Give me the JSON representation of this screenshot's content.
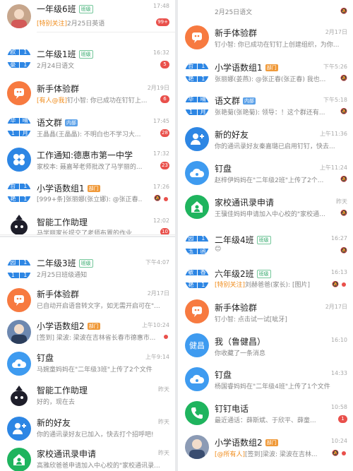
{
  "tl": {
    "rows": [
      {
        "title": "一年级6班",
        "tag": "班级",
        "sub_hl": "[特别关注]",
        "sub": "2月25日英语",
        "time": "17:48",
        "badge": "99+"
      },
      {
        "title": "二年级1班",
        "tag": "班级",
        "sub": "2月24日语文",
        "time": "16:32",
        "badge": "5",
        "av": [
          "欧",
          "1",
          "豪",
          "1"
        ]
      },
      {
        "title": "新手体验群",
        "sub_hl": "[有人@我]",
        "sub": "钉小智: 你已成功在钉钉上...",
        "time": "2月19日",
        "badge": "6"
      },
      {
        "title": "语文群",
        "tag": "内部",
        "sub": "王晶晶(王晶晶): 不明白也不学习大...",
        "time": "17:45",
        "badge": "28",
        "av": [
          "华",
          "晴",
          "1",
          "月"
        ]
      },
      {
        "title": "工作通知:德惠市第一中学",
        "sub": "家校本: 聂嘉琴老师批改了马学丽的...",
        "time": "17:32",
        "badge": "23"
      },
      {
        "title": "小学语数组1",
        "tag": "部门",
        "sub": "[999+条]张丽娜(张立娜): @张正春...",
        "time": "17:26",
        "av": [
          "哲",
          "1",
          "艳",
          "1"
        ]
      },
      {
        "title": "智能工作助理",
        "sub": "马学丽家长提交了老师布置的作业",
        "time": "12:02",
        "badge": "10"
      }
    ]
  },
  "bl": {
    "rows": [
      {
        "title": "二年级3班",
        "tag": "班级",
        "sub": "2月25日班级通知",
        "time": "下午4:07",
        "av": [
          "园",
          "1",
          "1",
          "1"
        ]
      },
      {
        "title": "新手体验群",
        "sub": "已自动开启语音转文字，如无需开启可在\"...",
        "time": "2月17日"
      },
      {
        "title": "小学语数组2",
        "tag": "部门",
        "sub": "[签到] 梁波: 梁波在吉林省长春市德惠市...",
        "time": "上午10:24"
      },
      {
        "title": "钉盘",
        "sub": "马婉童妈妈在\"二年级3班\"上传了2个文件",
        "time": "上午9:14"
      },
      {
        "title": "智能工作助理",
        "sub": "好的，现在去",
        "time": "昨天"
      },
      {
        "title": "新的好友",
        "sub": "你的通讯录好友已加入，快去打个招呼吧!",
        "time": "昨天"
      },
      {
        "title": "家校通讯录申请",
        "sub": "高雅欣爸爸申请加入中心校的\"家校通讯录...",
        "time": "昨天"
      }
    ]
  },
  "r": {
    "rows": [
      {
        "title": "",
        "sub": "2月25日语文",
        "time": ""
      },
      {
        "title": "新手体验群",
        "sub": "钉小智: 你已成功在钉钉上创建组织，为你...",
        "time": "2月17日"
      },
      {
        "title": "小学语数组1",
        "tag": "部门",
        "sub": "张丽娜(姜燕): @张正春(张正春) 我也...",
        "time": "下午5:26",
        "av": [
          "哲",
          "1",
          "艳",
          "1"
        ]
      },
      {
        "title": "语文群",
        "tag": "内部",
        "sub": "张艳菊(张艳菊): 领导：！这个群还有...",
        "time": "下午5:18",
        "av": [
          "华",
          "晴",
          "1",
          "月"
        ]
      },
      {
        "title": "新的好友",
        "sub": "你的通讯录好友秦嘉璐已启用钉钉，快去...",
        "time": "上午11:36"
      },
      {
        "title": "钉盘",
        "sub": "赵梓伊妈妈在\"二年级2班\"上传了2个...",
        "time": "上午11:24"
      },
      {
        "title": "家校通讯录申请",
        "sub": "王骥佳妈妈申请加入中心校的\"家校通...",
        "time": "昨天"
      },
      {
        "title": "二年级4班",
        "tag": "班级",
        "sub": "😊",
        "time": "16:27",
        "av": [
          "园",
          "1",
          "玉",
          "函"
        ]
      },
      {
        "title": "六年级2班",
        "tag": "班级",
        "sub_hl": "[特别关注]",
        "sub": "刘赫爸爸(家长): [图片]",
        "time": "16:13",
        "av": [
          "敏",
          "香",
          "艳",
          "1"
        ]
      },
      {
        "title": "新手体验群",
        "sub": "钉小智: 点击试一试[呲牙]",
        "time": "2月17日"
      },
      {
        "title": "我（鲁健昌）",
        "sub": "你收藏了一条消息",
        "time": "16:10",
        "av_text": "健昌"
      },
      {
        "title": "钉盘",
        "sub": "杨国睿妈妈在\"二年级4班\"上传了1个文件",
        "time": "14:33"
      },
      {
        "title": "钉钉电话",
        "sub": "最近通话：薛斯斌、于欣平、薛童...",
        "time": "10:58",
        "badge": "1"
      },
      {
        "title": "小学语数组2",
        "tag": "部门",
        "sub_hl": "[@所有人]",
        "sub": "[签到]梁波: 梁波在吉林...",
        "time": "10:24"
      }
    ]
  },
  "tabs": [
    "◦",
    "◦",
    "◦",
    "◦",
    "▣"
  ],
  "more": "···",
  "colors": {
    "accent": "#2d86e4",
    "badge": "#e9504b",
    "orange": "#f77a40",
    "green": "#1fb45e"
  }
}
